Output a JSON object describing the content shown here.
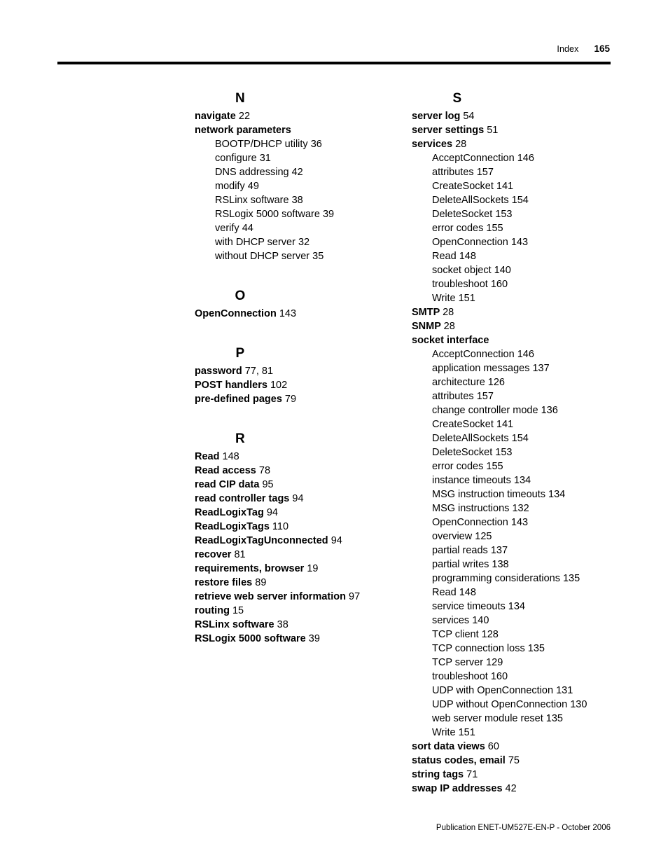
{
  "header": {
    "section_label": "Index",
    "page_number": "165"
  },
  "footer": {
    "publication_line": "Publication ENET-UM527E-EN-P - October 2006"
  },
  "columns": {
    "left": [
      {
        "letter": "N",
        "entries": [
          {
            "level": "main",
            "term": "navigate",
            "pages": "22"
          },
          {
            "level": "main",
            "term": "network parameters",
            "pages": ""
          },
          {
            "level": "sub",
            "term": "BOOTP/DHCP utility",
            "pages": "36"
          },
          {
            "level": "sub",
            "term": "configure",
            "pages": "31"
          },
          {
            "level": "sub",
            "term": "DNS addressing",
            "pages": "42"
          },
          {
            "level": "sub",
            "term": "modify",
            "pages": "49"
          },
          {
            "level": "sub",
            "term": "RSLinx software",
            "pages": "38"
          },
          {
            "level": "sub",
            "term": "RSLogix 5000 software",
            "pages": "39"
          },
          {
            "level": "sub",
            "term": "verify",
            "pages": "44"
          },
          {
            "level": "sub",
            "term": "with DHCP server",
            "pages": "32"
          },
          {
            "level": "sub",
            "term": "without DHCP server",
            "pages": "35"
          }
        ]
      },
      {
        "letter": "O",
        "entries": [
          {
            "level": "main",
            "term": "OpenConnection",
            "pages": "143"
          }
        ]
      },
      {
        "letter": "P",
        "entries": [
          {
            "level": "main",
            "term": "password",
            "pages": "77, 81"
          },
          {
            "level": "main",
            "term": "POST handlers",
            "pages": "102"
          },
          {
            "level": "main",
            "term": "pre-defined pages",
            "pages": "79"
          }
        ]
      },
      {
        "letter": "R",
        "entries": [
          {
            "level": "main",
            "term": "Read",
            "pages": "148"
          },
          {
            "level": "main",
            "term": "Read access",
            "pages": "78"
          },
          {
            "level": "main",
            "term": "read CIP data",
            "pages": "95"
          },
          {
            "level": "main",
            "term": "read controller tags",
            "pages": "94"
          },
          {
            "level": "main",
            "term": "ReadLogixTag",
            "pages": "94"
          },
          {
            "level": "main",
            "term": "ReadLogixTags",
            "pages": "110"
          },
          {
            "level": "main",
            "term": "ReadLogixTagUnconnected",
            "pages": "94"
          },
          {
            "level": "main",
            "term": "recover",
            "pages": "81"
          },
          {
            "level": "main",
            "term": "requirements, browser",
            "pages": "19"
          },
          {
            "level": "main",
            "term": "restore files",
            "pages": "89"
          },
          {
            "level": "main",
            "term": "retrieve web server information",
            "pages": "97"
          },
          {
            "level": "main",
            "term": "routing",
            "pages": "15"
          },
          {
            "level": "main",
            "term": "RSLinx software",
            "pages": "38"
          },
          {
            "level": "main",
            "term": "RSLogix 5000 software",
            "pages": "39"
          }
        ]
      }
    ],
    "right": [
      {
        "letter": "S",
        "entries": [
          {
            "level": "main",
            "term": "server log",
            "pages": "54"
          },
          {
            "level": "main",
            "term": "server settings",
            "pages": "51"
          },
          {
            "level": "main",
            "term": "services",
            "pages": "28"
          },
          {
            "level": "sub",
            "term": "AcceptConnection",
            "pages": "146"
          },
          {
            "level": "sub",
            "term": "attributes",
            "pages": "157"
          },
          {
            "level": "sub",
            "term": "CreateSocket",
            "pages": "141"
          },
          {
            "level": "sub",
            "term": "DeleteAllSockets",
            "pages": "154"
          },
          {
            "level": "sub",
            "term": "DeleteSocket",
            "pages": "153"
          },
          {
            "level": "sub",
            "term": "error codes",
            "pages": "155"
          },
          {
            "level": "sub",
            "term": "OpenConnection",
            "pages": "143"
          },
          {
            "level": "sub",
            "term": "Read",
            "pages": "148"
          },
          {
            "level": "sub",
            "term": "socket object",
            "pages": "140"
          },
          {
            "level": "sub",
            "term": "troubleshoot",
            "pages": "160"
          },
          {
            "level": "sub",
            "term": "Write",
            "pages": "151"
          },
          {
            "level": "main",
            "term": "SMTP",
            "pages": "28"
          },
          {
            "level": "main",
            "term": "SNMP",
            "pages": "28"
          },
          {
            "level": "main",
            "term": "socket interface",
            "pages": ""
          },
          {
            "level": "sub",
            "term": "AcceptConnection",
            "pages": "146"
          },
          {
            "level": "sub",
            "term": "application messages",
            "pages": "137"
          },
          {
            "level": "sub",
            "term": "architecture",
            "pages": "126"
          },
          {
            "level": "sub",
            "term": "attributes",
            "pages": "157"
          },
          {
            "level": "sub",
            "term": "change controller mode",
            "pages": "136"
          },
          {
            "level": "sub",
            "term": "CreateSocket",
            "pages": "141"
          },
          {
            "level": "sub",
            "term": "DeleteAllSockets",
            "pages": "154"
          },
          {
            "level": "sub",
            "term": "DeleteSocket",
            "pages": "153"
          },
          {
            "level": "sub",
            "term": "error codes",
            "pages": "155"
          },
          {
            "level": "sub",
            "term": "instance timeouts",
            "pages": "134"
          },
          {
            "level": "sub",
            "term": "MSG instruction timeouts",
            "pages": "134"
          },
          {
            "level": "sub",
            "term": "MSG instructions",
            "pages": "132"
          },
          {
            "level": "sub",
            "term": "OpenConnection",
            "pages": "143"
          },
          {
            "level": "sub",
            "term": "overview",
            "pages": "125"
          },
          {
            "level": "sub",
            "term": "partial reads",
            "pages": "137"
          },
          {
            "level": "sub",
            "term": "partial writes",
            "pages": "138"
          },
          {
            "level": "sub",
            "term": "programming considerations",
            "pages": "135"
          },
          {
            "level": "sub",
            "term": "Read",
            "pages": "148"
          },
          {
            "level": "sub",
            "term": "service timeouts",
            "pages": "134"
          },
          {
            "level": "sub",
            "term": "services",
            "pages": "140"
          },
          {
            "level": "sub",
            "term": "TCP client",
            "pages": "128"
          },
          {
            "level": "sub",
            "term": "TCP connection loss",
            "pages": "135"
          },
          {
            "level": "sub",
            "term": "TCP server",
            "pages": "129"
          },
          {
            "level": "sub",
            "term": "troubleshoot",
            "pages": "160"
          },
          {
            "level": "sub",
            "term": "UDP with OpenConnection",
            "pages": "131"
          },
          {
            "level": "sub",
            "term": "UDP without OpenConnection",
            "pages": "130"
          },
          {
            "level": "sub",
            "term": "web server module reset",
            "pages": "135"
          },
          {
            "level": "sub",
            "term": "Write",
            "pages": "151"
          },
          {
            "level": "main",
            "term": "sort data views",
            "pages": "60"
          },
          {
            "level": "main",
            "term": "status codes, email",
            "pages": "75"
          },
          {
            "level": "main",
            "term": "string tags",
            "pages": "71"
          },
          {
            "level": "main",
            "term": "swap IP addresses",
            "pages": "42"
          }
        ]
      }
    ]
  }
}
